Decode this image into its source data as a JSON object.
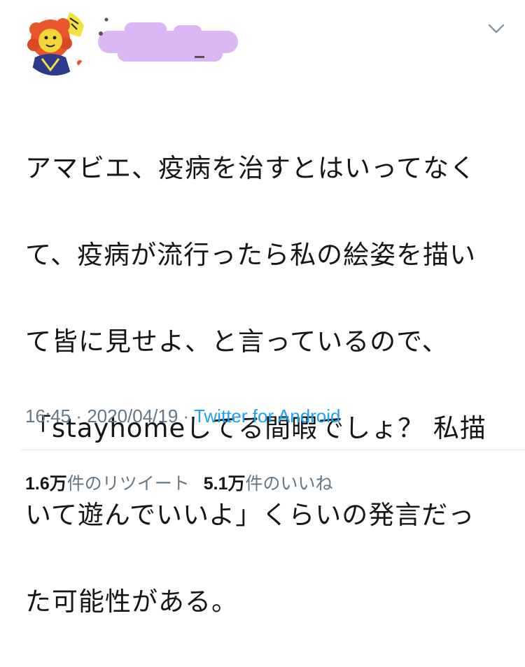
{
  "colors": {
    "text": "#14171a",
    "secondary": "#657786",
    "link": "#1da1f2",
    "redaction": "#d9b3f2",
    "divider": "#e1e8ed"
  },
  "tweet": {
    "lines": [
      "アマビエ、疫病を治すとはいってなく",
      "て、疫病が流行ったら私の絵姿を描い",
      "て皆に見せよ、と言っているので、",
      "「stayhomeしてる間暇でしょ？ 私描",
      "いて遊んでいいよ」くらいの発言だっ",
      "た可能性がある。"
    ],
    "time": "16:45",
    "separator": " · ",
    "date": "2020/04/19",
    "source": "Twitter for Android",
    "retweet_count": "1.6万",
    "retweet_label": "件のリツイート",
    "like_count": "5.1万",
    "like_label": "件のいいね"
  },
  "icons": {
    "menu": "chevron-down-icon",
    "avatar": "lion-avatar"
  }
}
